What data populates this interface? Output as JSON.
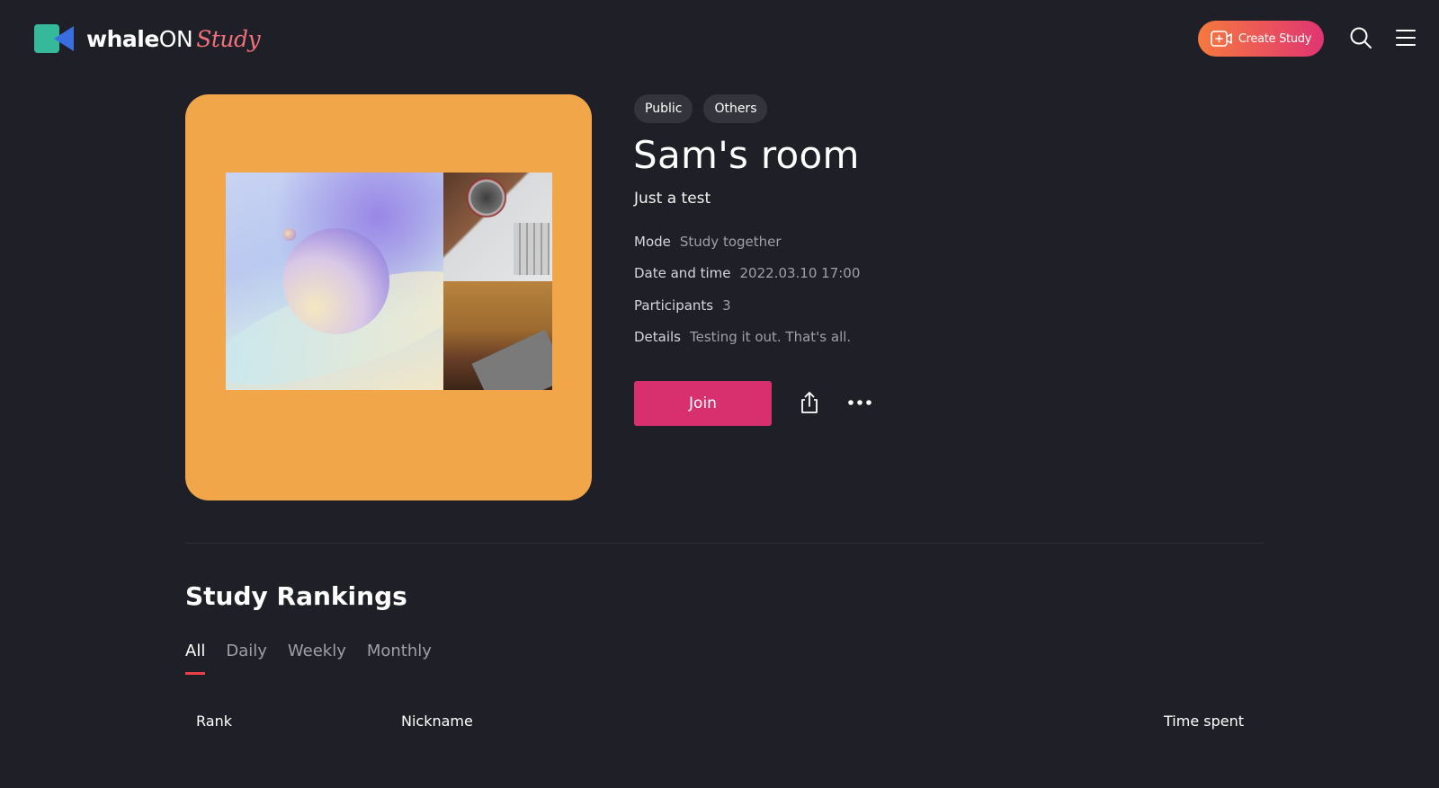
{
  "header": {
    "logo_main": "whale",
    "logo_on": "ON",
    "logo_study": "Study",
    "create_label": "Create Study",
    "colors": {
      "accent_start": "#f5793e",
      "accent_end": "#e03572",
      "logo_study": "#f2707a"
    }
  },
  "room": {
    "tags": [
      "Public",
      "Others"
    ],
    "title": "Sam's room",
    "subtitle": "Just a test",
    "info": [
      {
        "key": "Mode",
        "value": "Study together"
      },
      {
        "key": "Date and time",
        "value": "2022.03.10 17:00"
      },
      {
        "key": "Participants",
        "value": "3"
      },
      {
        "key": "Details",
        "value": "Testing it out. That's all."
      }
    ],
    "join_label": "Join",
    "cover_color": "#f1a64a",
    "join_color": "#d8306f"
  },
  "rankings": {
    "title": "Study Rankings",
    "tabs": [
      {
        "label": "All",
        "active": true
      },
      {
        "label": "Daily",
        "active": false
      },
      {
        "label": "Weekly",
        "active": false
      },
      {
        "label": "Monthly",
        "active": false
      }
    ],
    "columns": {
      "rank": "Rank",
      "nickname": "Nickname",
      "time": "Time spent"
    }
  }
}
